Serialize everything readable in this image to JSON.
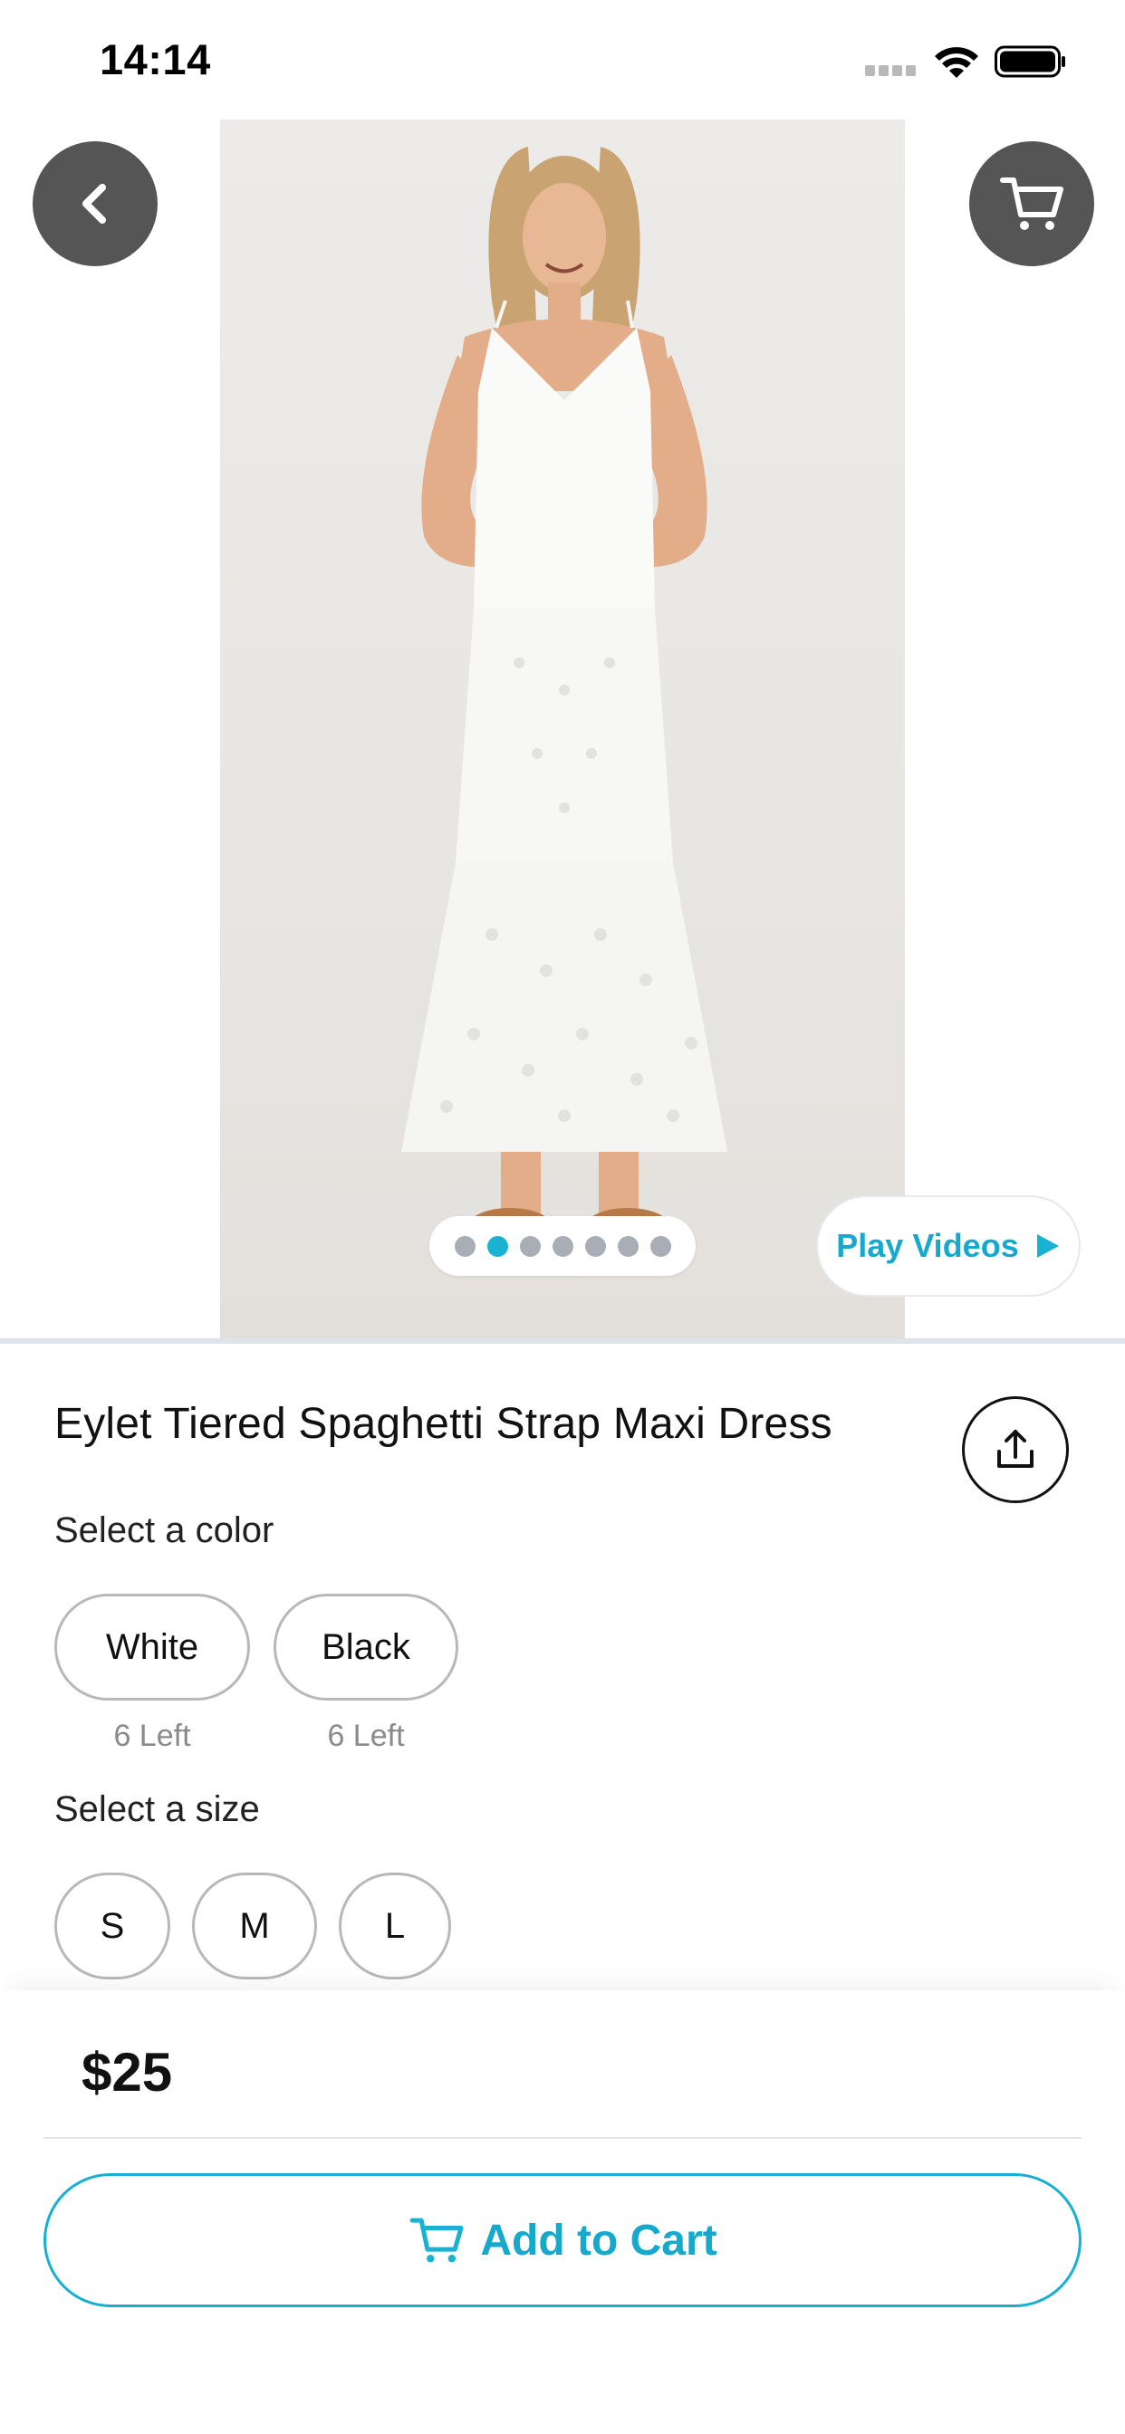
{
  "status_bar": {
    "time": "14:14"
  },
  "product": {
    "title": "Eylet Tiered Spaghetti Strap Maxi Dress",
    "image_count": 7,
    "active_image_index": 2,
    "price": "$25"
  },
  "gallery": {
    "play_videos_label": "Play Videos"
  },
  "colors": {
    "label": "Select a color",
    "options": [
      {
        "name": "White",
        "stock": "6 Left"
      },
      {
        "name": "Black",
        "stock": "6 Left"
      }
    ]
  },
  "sizes": {
    "label": "Select a size",
    "options": [
      "S",
      "M",
      "L"
    ]
  },
  "actions": {
    "add_to_cart_label": "Add to Cart"
  },
  "theme": {
    "accent": "#19b2d3",
    "button_dark": "#555555",
    "dot_inactive": "#a9adb5"
  }
}
